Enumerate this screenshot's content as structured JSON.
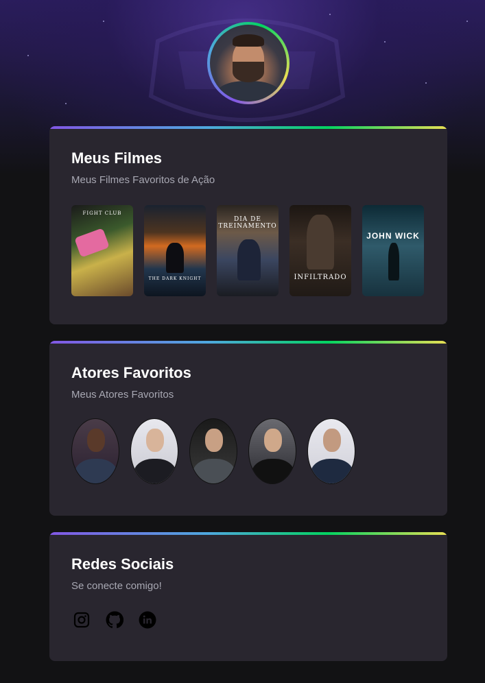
{
  "profile": {
    "avatar_icon": "user-avatar"
  },
  "movies": {
    "title": "Meus Filmes",
    "subtitle": "Meus Filmes Favoritos de Ação",
    "posters": [
      {
        "name": "fight-club-poster",
        "caption": "FIGHT CLUB"
      },
      {
        "name": "dark-knight-poster",
        "caption": "THE DARK KNIGHT"
      },
      {
        "name": "training-day-poster",
        "caption": "DIA DE TREINAMENTO"
      },
      {
        "name": "infiltrado-poster",
        "caption": "INFILTRADO"
      },
      {
        "name": "john-wick-poster",
        "caption": "JOHN WICK"
      }
    ]
  },
  "actors": {
    "title": "Atores Favoritos",
    "subtitle": "Meus Atores Favoritos"
  },
  "social": {
    "title": "Redes Sociais",
    "subtitle": "Se conecte comigo!",
    "icons": [
      "instagram-icon",
      "github-icon",
      "linkedin-icon"
    ]
  },
  "colors": {
    "background": "#121214",
    "card": "#29262f",
    "accent_gradient": [
      "#8257e5",
      "#4ea8de",
      "#04d361",
      "#e8df54"
    ]
  }
}
